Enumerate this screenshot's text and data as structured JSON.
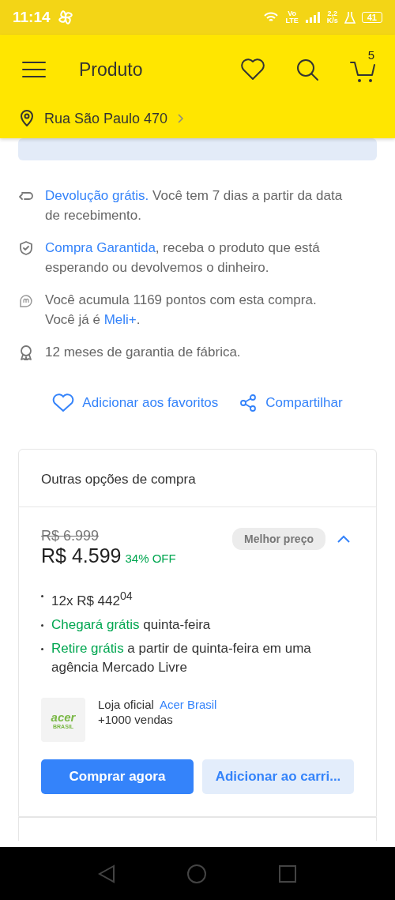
{
  "status_bar": {
    "time": "11:14",
    "network": "Vo\nLTE",
    "speed": "2,2\nK/s",
    "battery": "41"
  },
  "header": {
    "title": "Produto",
    "cart_count": "5",
    "address": "Rua São Paulo 470"
  },
  "benefits": [
    {
      "segments": [
        {
          "kind": "link",
          "text": "Devolução grátis."
        },
        {
          "kind": "text",
          "text": " Você tem 7 dias a partir da data de recebimento."
        }
      ]
    },
    {
      "segments": [
        {
          "kind": "link",
          "text": "Compra Garantida"
        },
        {
          "kind": "text",
          "text": ", receba o produto que está esperando ou devolvemos o dinheiro."
        }
      ]
    },
    {
      "segments": [
        {
          "kind": "text",
          "text": "Você acumula 1169 pontos com esta compra. Você já é "
        },
        {
          "kind": "link",
          "text": "Meli+"
        },
        {
          "kind": "text",
          "text": "."
        }
      ]
    },
    {
      "segments": [
        {
          "kind": "text",
          "text": "12 meses de garantia de fábrica."
        }
      ]
    }
  ],
  "actions": [
    {
      "label": "Adicionar aos favoritos"
    },
    {
      "label": "Compartilhar"
    }
  ],
  "other_options": {
    "title": "Outras opções de compra",
    "offer": {
      "old_price": "R$ 6.999",
      "price": "R$ 4.599",
      "discount": "34% OFF",
      "badge": "Melhor preço",
      "expanded": true,
      "bullets": [
        [
          {
            "kind": "text",
            "text": "12x R$ 442$^{04}$"
          }
        ],
        [
          {
            "kind": "highlight",
            "text": "Chegará grátis"
          },
          {
            "kind": "text",
            "text": " quinta-feira"
          }
        ],
        [
          {
            "kind": "highlight",
            "text": "Retire grátis"
          },
          {
            "kind": "text",
            "text": " a partir de quinta-feira em uma agência Mercado Livre"
          }
        ]
      ],
      "seller": {
        "logo": "acer",
        "logo_sub": "BRASIL",
        "label": "Loja oficial",
        "name": "Acer Brasil",
        "sales": "+1000 vendas"
      },
      "buttons": [
        {
          "kind": "primary",
          "label": "Comprar agora"
        },
        {
          "kind": "secondary",
          "label": "Adicionar ao carri..."
        }
      ]
    }
  }
}
